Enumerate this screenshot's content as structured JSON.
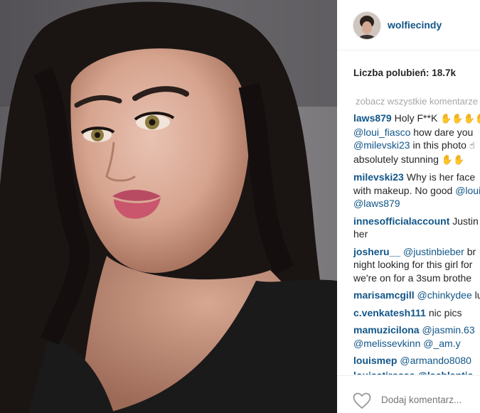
{
  "post": {
    "username": "wolfiecindy",
    "likes_label": "Liczba polubień: 18.7k",
    "view_all_label": "zobacz wszystkie komentarze"
  },
  "comments": [
    {
      "user": "laws879",
      "lines": [
        [
          {
            "t": "text",
            "v": " Holy F**K "
          },
          {
            "t": "emoji",
            "v": "✋✋✋✋"
          }
        ],
        [
          {
            "t": "mention",
            "v": "@loui_fiasco"
          },
          {
            "t": "text",
            "v": " how dare you"
          }
        ],
        [
          {
            "t": "mention",
            "v": "@milevski23"
          },
          {
            "t": "text",
            "v": " in this photo "
          },
          {
            "t": "emoji",
            "v": "☝"
          }
        ],
        [
          {
            "t": "text",
            "v": "absolutely stunning "
          },
          {
            "t": "emoji",
            "v": "✋✋"
          }
        ]
      ]
    },
    {
      "user": "milevski23",
      "lines": [
        [
          {
            "t": "text",
            "v": " Why is her face"
          }
        ],
        [
          {
            "t": "text",
            "v": "with makeup. No good "
          },
          {
            "t": "mention",
            "v": "@loui"
          }
        ],
        [
          {
            "t": "mention",
            "v": "@laws879"
          }
        ]
      ]
    },
    {
      "user": "innesofficialaccount",
      "lines": [
        [
          {
            "t": "text",
            "v": " Justin"
          }
        ],
        [
          {
            "t": "text",
            "v": "her"
          }
        ]
      ]
    },
    {
      "user": "josheru__",
      "lines": [
        [
          {
            "t": "text",
            "v": " "
          },
          {
            "t": "mention",
            "v": "@justinbieber"
          },
          {
            "t": "text",
            "v": " br"
          }
        ],
        [
          {
            "t": "text",
            "v": "night looking for this girl for"
          }
        ],
        [
          {
            "t": "text",
            "v": "we're on for a 3sum brothe"
          }
        ]
      ]
    },
    {
      "user": "marisamcgill",
      "lines": [
        [
          {
            "t": "text",
            "v": " "
          },
          {
            "t": "mention",
            "v": "@chinkydee"
          },
          {
            "t": "text",
            "v": " lu"
          }
        ]
      ]
    },
    {
      "user": "c.venkatesh111",
      "lines": [
        [
          {
            "t": "text",
            "v": " nic pics"
          }
        ]
      ]
    },
    {
      "user": "mamuzicilona",
      "lines": [
        [
          {
            "t": "text",
            "v": " "
          },
          {
            "t": "mention",
            "v": "@jasmin.63"
          }
        ],
        [
          {
            "t": "mention",
            "v": "@melissevkinn"
          },
          {
            "t": "text",
            "v": " "
          },
          {
            "t": "mention",
            "v": "@_am.y"
          }
        ]
      ]
    },
    {
      "user": "louismep",
      "lines": [
        [
          {
            "t": "text",
            "v": " "
          },
          {
            "t": "mention",
            "v": "@armando8080"
          }
        ]
      ]
    }
  ],
  "cut_off_row": "louisatirosss @lachlantia",
  "footer": {
    "like_icon": "heart-outline-icon",
    "add_comment_placeholder": "Dodaj komentarz..."
  },
  "colors": {
    "link": "#125688",
    "text": "#262626",
    "muted": "#a5a7aa",
    "divider": "#efefef"
  }
}
